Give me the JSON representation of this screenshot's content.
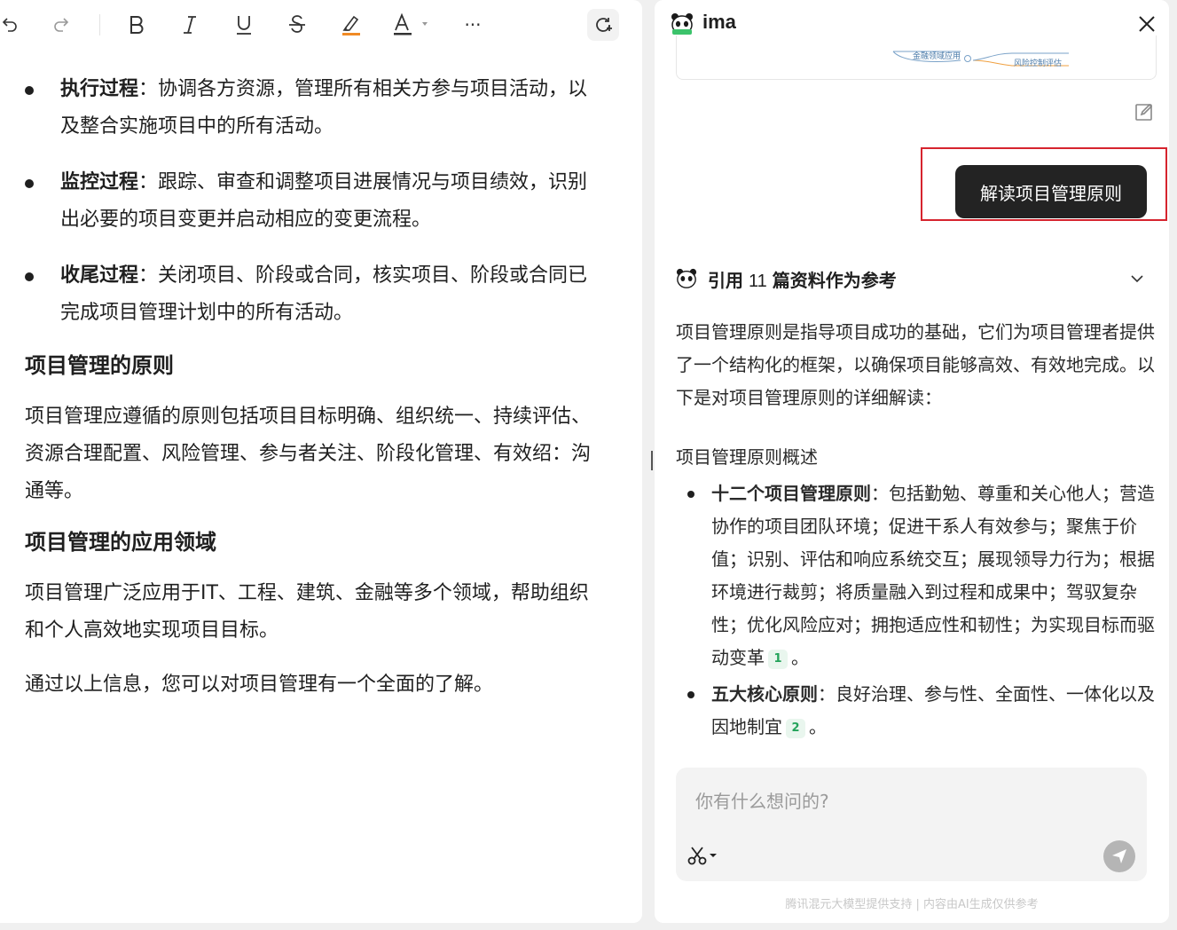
{
  "editor": {
    "toolbar": {
      "more": "···"
    },
    "bullets": [
      {
        "bold": "执行过程",
        "text": "：协调各方资源，管理所有相关方参与项目活动，以及整合实施项目中的所有活动。"
      },
      {
        "bold": "监控过程",
        "text": "：跟踪、审查和调整项目进展情况与项目绩效，识别出必要的项目变更并启动相应的变更流程。"
      },
      {
        "bold": "收尾过程",
        "text": "：关闭项目、阶段或合同，核实项目、阶段或合同已完成项目管理计划中的所有活动。"
      }
    ],
    "heading_principles": "项目管理的原则",
    "para_principles": "项目管理应遵循的原则包括项目目标明确、组织统一、持续评估、资源合理配置、风险管理、参与者关注、阶段化管理、有效绍：沟通等。",
    "heading_fields": "项目管理的应用领域",
    "para_fields": "项目管理广泛应用于IT、工程、建筑、金融等多个领域，帮助组织和个人高效地实现项目目标。",
    "para_conclusion": "通过以上信息，您可以对项目管理有一个全面的了解。"
  },
  "ai": {
    "title": "ima",
    "mindmap": {
      "node_left": "金融领域应用",
      "node_right": "风险控制评估"
    },
    "user_message": "解读项目管理原则",
    "refs": {
      "prefix": "引用",
      "count": "11",
      "suffix": "篇资料作为参考"
    },
    "answer": {
      "intro": "项目管理原则是指导项目成功的基础，它们为项目管理者提供了一个结构化的框架，以确保项目能够高效、有效地完成。以下是对项目管理原则的详细解读：",
      "subtitle": "项目管理原则概述",
      "items": [
        {
          "bold": "十二个项目管理原则",
          "text": "：包括勤勉、尊重和关心他人；营造协作的项目团队环境；促进干系人有效参与；聚焦于价值；识别、评估和响应系统交互；展现领导力行为；根据环境进行裁剪；将质量融入到过程和成果中；驾驭复杂性；优化风险应对；拥抱适应性和韧性；为实现目标而驱动变革",
          "cite": "1",
          "end": "。"
        },
        {
          "bold": "五大核心原则",
          "text": "：良好治理、参与性、全面性、一体化以及因地制宜",
          "cite": "2",
          "end": "。"
        }
      ]
    },
    "input_placeholder": "你有什么想问的?",
    "footer": "腾讯混元大模型提供支持 | 内容由AI生成仅供参考"
  },
  "colors": {
    "highlight": "#d6242e",
    "user_bubble": "#232323",
    "cite_green": "#23a35a",
    "marker_orange": "#f08a24"
  }
}
